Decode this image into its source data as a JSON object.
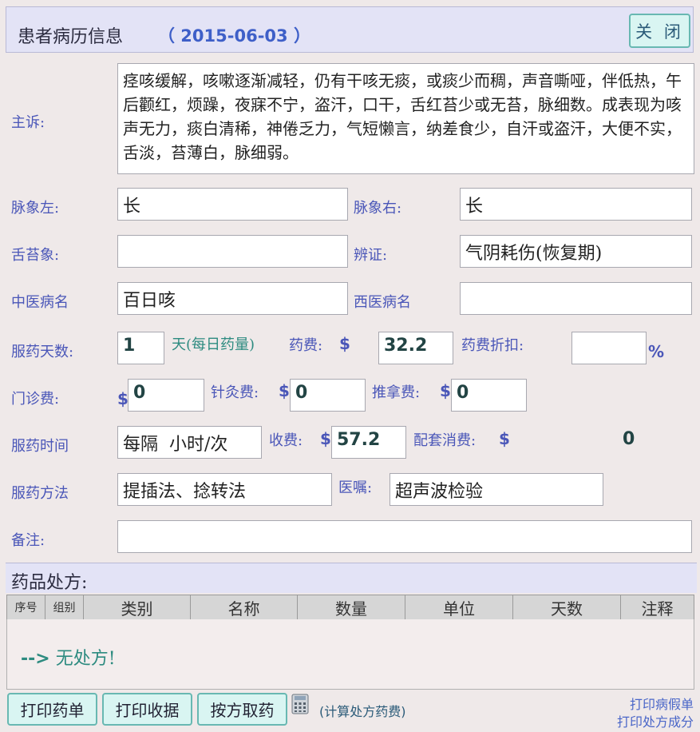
{
  "header": {
    "title": "患者病历信息",
    "date": "（ 2015-06-03 ）",
    "close_label": "关 闭"
  },
  "chief_complaint": {
    "label": "主诉:",
    "value": "痉咳缓解，咳嗽逐渐减轻，仍有干咳无痰，或痰少而稠，声音嘶哑，伴低热，午后颧红，烦躁，夜寐不宁，盗汗，口干，舌红苔少或无苔，脉细数。成表现为咳声无力，痰白清稀，神倦乏力，气短懒言，纳差食少，自汗或盗汗，大便不实，舌淡，苔薄白，脉细弱。"
  },
  "pulse_left": {
    "label": "脉象左:",
    "value": "长"
  },
  "pulse_right": {
    "label": "脉象右:",
    "value": "长"
  },
  "tongue": {
    "label": "舌苔象:",
    "value": ""
  },
  "syndrome": {
    "label": "辨证:",
    "value": "气阴耗伤(恢复期)"
  },
  "tcm_disease": {
    "label": "中医病名",
    "value": "百日咳"
  },
  "western_disease": {
    "label": "西医病名",
    "value": ""
  },
  "days": {
    "label": "服药天数:",
    "value": "1",
    "unit": "天(每日药量)"
  },
  "drug_fee": {
    "label": "药费:",
    "currency": "$",
    "value": "32.2"
  },
  "discount": {
    "label": "药费折扣:",
    "value": "",
    "unit": "%"
  },
  "clinic_fee": {
    "label": "门诊费:",
    "currency": "$",
    "value": "0"
  },
  "acupuncture_fee": {
    "label": "针灸费:",
    "currency": "$",
    "value": "0"
  },
  "massage_fee": {
    "label": "推拿费:",
    "currency": "$",
    "value": "0"
  },
  "dosing_time": {
    "label": "服药时间",
    "value": "每隔  小时/次"
  },
  "charge": {
    "label": "收费:",
    "currency": "$",
    "value": "57.2"
  },
  "supplies_fee": {
    "label": "配套消费:",
    "currency": "$",
    "value": "0"
  },
  "method": {
    "label": "服药方法",
    "value": "提插法、捻转法"
  },
  "orders": {
    "label": "医嘱:",
    "value": "超声波检验"
  },
  "notes": {
    "label": "备注:",
    "value": ""
  },
  "prescription": {
    "title": "药品处方:",
    "columns": [
      "序号",
      "组别",
      "类别",
      "名称",
      "数量",
      "单位",
      "天数",
      "注释"
    ],
    "empty_arrow": "-->",
    "empty_text": "无处方!"
  },
  "footer": {
    "print_drugs": "打印药单",
    "print_receipt": "打印收据",
    "take_by_rx": "按方取药",
    "calc_note": "(计算处方药费)",
    "print_sick_leave": "打印病假单",
    "print_rx_components": "打印处方成分"
  }
}
